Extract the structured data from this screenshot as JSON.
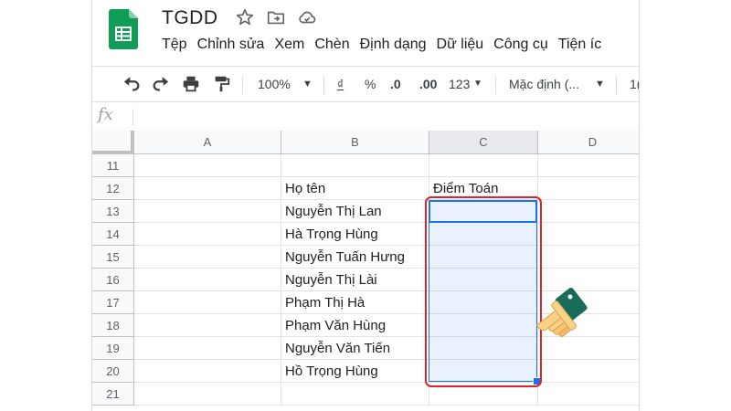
{
  "app": {
    "title": "TGDD",
    "title_icons": [
      "star-icon",
      "move-to-folder-icon",
      "cloud-status-icon"
    ]
  },
  "menu": {
    "items": [
      "Tệp",
      "Chỉnh sửa",
      "Xem",
      "Chèn",
      "Định dạng",
      "Dữ liệu",
      "Công cụ",
      "Tiện íc"
    ]
  },
  "toolbar": {
    "zoom": "100%",
    "currency": "₫",
    "percent": "%",
    "dec_decrease": ".0",
    "dec_increase": ".00",
    "more_formats": "123",
    "font": "Mặc định (...",
    "font_size": "1("
  },
  "formula_bar": {
    "fx_label": "fx",
    "value": ""
  },
  "sheet": {
    "columns": [
      "A",
      "B",
      "C",
      "D"
    ],
    "selected_column": "C",
    "rows": [
      {
        "num": "11",
        "B": "",
        "C": ""
      },
      {
        "num": "12",
        "B": "Họ tên",
        "C": "Điểm Toán"
      },
      {
        "num": "13",
        "B": "Nguyễn Thị Lan",
        "C": ""
      },
      {
        "num": "14",
        "B": "Hà Trọng Hùng",
        "C": ""
      },
      {
        "num": "15",
        "B": "Nguyễn Tuấn Hưng",
        "C": ""
      },
      {
        "num": "16",
        "B": "Nguyễn Thị Lài",
        "C": ""
      },
      {
        "num": "17",
        "B": "Phạm Thị Hà",
        "C": ""
      },
      {
        "num": "18",
        "B": "Phạm Văn Hùng",
        "C": ""
      },
      {
        "num": "19",
        "B": "Nguyễn Văn Tiến",
        "C": ""
      },
      {
        "num": "20",
        "B": "Hồ Trọng Hùng",
        "C": ""
      },
      {
        "num": "21",
        "B": "",
        "C": ""
      }
    ]
  },
  "colors": {
    "selection": "#1a73e8",
    "highlight": "#e0222a",
    "sheets_green": "#0f9d58"
  }
}
